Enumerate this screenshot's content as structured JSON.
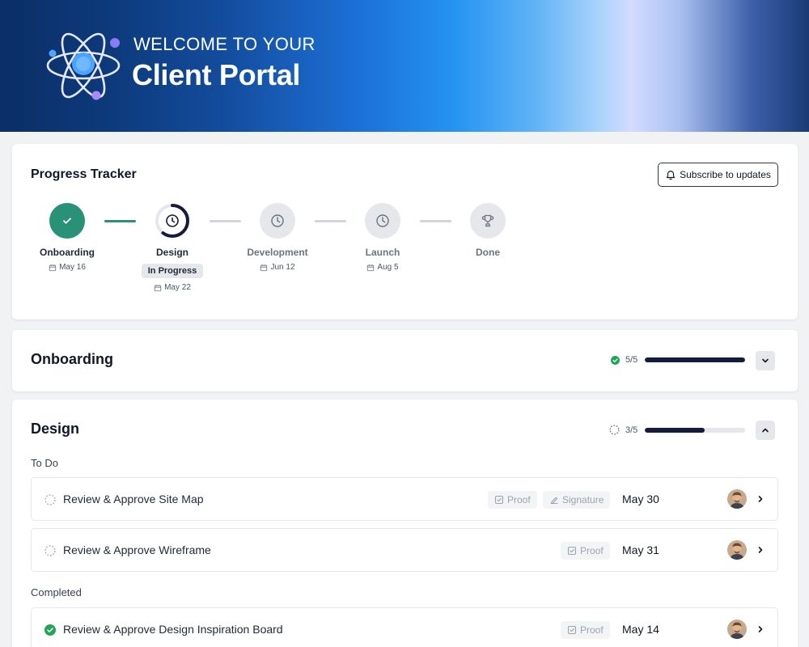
{
  "hero": {
    "kicker": "WELCOME TO YOUR",
    "title": "Client Portal",
    "logo_icon": "atom-logo-icon"
  },
  "tracker": {
    "title": "Progress Tracker",
    "subscribe_label": "Subscribe to updates",
    "steps": [
      {
        "label": "Onboarding",
        "date": "May 16",
        "status": "done"
      },
      {
        "label": "Design",
        "date": "May 22",
        "status": "in-progress",
        "badge": "In Progress"
      },
      {
        "label": "Development",
        "date": "Jun 12",
        "status": "upcoming"
      },
      {
        "label": "Launch",
        "date": "Aug 5",
        "status": "upcoming"
      },
      {
        "label": "Done",
        "date": "",
        "status": "upcoming"
      }
    ]
  },
  "onboarding": {
    "title": "Onboarding",
    "count": "5/5",
    "progress": 1.0
  },
  "design": {
    "title": "Design",
    "count": "3/5",
    "progress": 0.6,
    "todo_label": "To Do",
    "completed_label": "Completed",
    "tasks_todo": [
      {
        "title": "Review & Approve Site Map",
        "tags": [
          "Proof",
          "Signature"
        ],
        "date": "May 30"
      },
      {
        "title": "Review & Approve Wireframe",
        "tags": [
          "Proof"
        ],
        "date": "May 31"
      }
    ],
    "tasks_completed": [
      {
        "title": "Review & Approve Design Inspiration Board",
        "tags": [
          "Proof"
        ],
        "date": "May 14"
      }
    ]
  },
  "colors": {
    "accent_green": "#2a9179",
    "progress_dark": "#141b3d",
    "check_green": "#22a559"
  }
}
